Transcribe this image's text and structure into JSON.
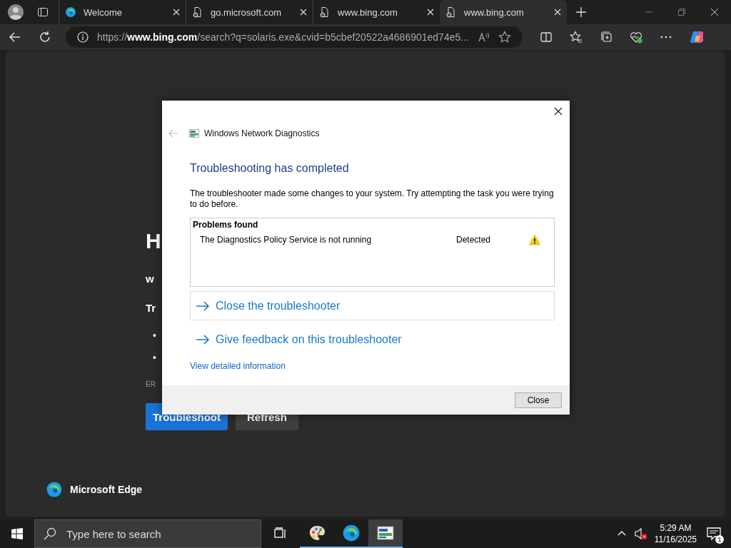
{
  "browser": {
    "tabs": [
      {
        "title": "Welcome",
        "kind": "edge",
        "selected": false
      },
      {
        "title": "go.microsoft.com",
        "kind": "page",
        "selected": false
      },
      {
        "title": "www.bing.com",
        "kind": "page",
        "selected": false
      },
      {
        "title": "www.bing.com",
        "kind": "page",
        "selected": true
      }
    ],
    "address": "https://**www.bing.com**/search?q=solaris.exe&cvid=b5cbef20522a4686901ed74e5..."
  },
  "background_page": {
    "heading": "H",
    "site": "w",
    "subheading": "Tr",
    "bullets": [
      "•",
      "•"
    ],
    "error_code": "ER",
    "buttons": [
      {
        "label": "Troubleshoot",
        "kind": "primary"
      },
      {
        "label": "Refresh",
        "kind": "secondary"
      }
    ],
    "brand": "Microsoft Edge"
  },
  "dialog": {
    "title": "Windows Network Diagnostics",
    "heading": "Troubleshooting has completed",
    "message": "The troubleshooter made some changes to your system. Try attempting the task you were trying to do before.",
    "problems": {
      "header": "Problems found",
      "rows": [
        {
          "problem": "The Diagnostics Policy Service is not running",
          "status": "Detected"
        }
      ]
    },
    "commands": [
      {
        "label": "Close the troubleshooter",
        "focused": true
      },
      {
        "label": "Give feedback on this troubleshooter",
        "focused": false
      }
    ],
    "details_link": "View detailed information",
    "close_button": "Close"
  },
  "taskbar": {
    "search": {
      "placeholder": "Type here to search"
    },
    "apps": [
      {
        "kind": "paint",
        "running": true,
        "selected": false
      },
      {
        "kind": "edge",
        "running": true,
        "selected": false
      },
      {
        "kind": "diagnostics",
        "running": true,
        "selected": true
      }
    ],
    "time": "5:29 AM",
    "date": "11/16/2025",
    "notifications": "1"
  }
}
